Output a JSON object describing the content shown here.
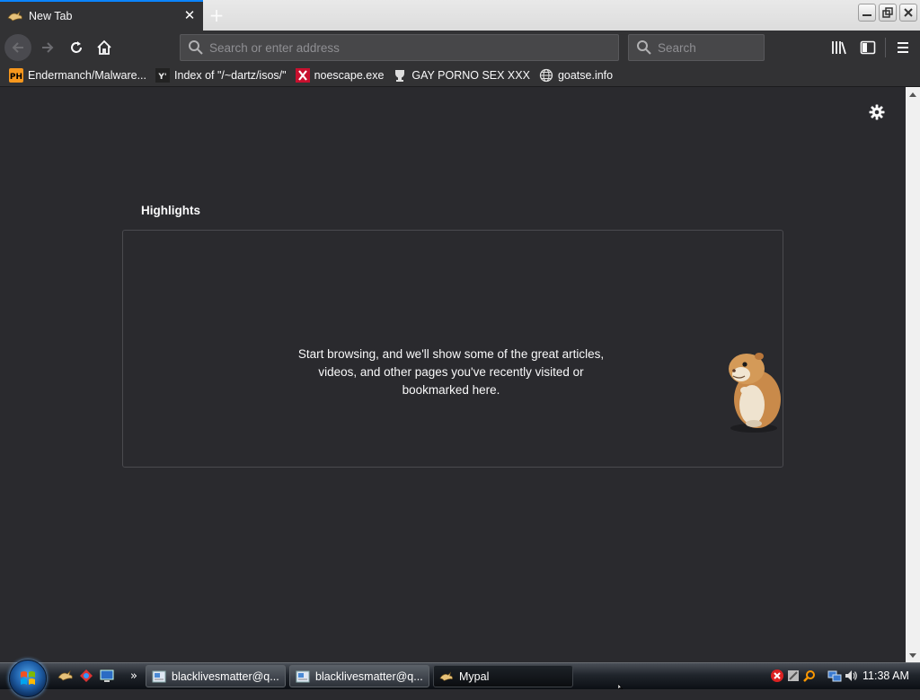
{
  "tabs": [
    {
      "title": "New Tab",
      "icon": "mypal-favicon-icon",
      "active": true
    }
  ],
  "window_controls": {
    "minimize": "minimize-icon",
    "restore": "restore-icon",
    "close": "close-icon"
  },
  "navbar": {
    "url_placeholder": "Search or enter address",
    "search_placeholder": "Search"
  },
  "bookmarks": [
    {
      "label": "Endermanch/Malware...",
      "icon": "ph-icon"
    },
    {
      "label": "Index of \"/~dartz/isos/\"",
      "icon": "yc-icon"
    },
    {
      "label": "noescape.exe",
      "icon": "x-icon"
    },
    {
      "label": "GAY PORNO SEX XXX",
      "icon": "trophy-icon"
    },
    {
      "label": "goatse.info",
      "icon": "globe-icon"
    }
  ],
  "content": {
    "highlights_title": "Highlights",
    "empty_message": "Start browsing, and we'll show some of the great articles, videos, and other pages you've recently visited or bookmarked here."
  },
  "taskbar": {
    "buttons": [
      {
        "label": "blacklivesmatter@q...",
        "icon": "mail-icon",
        "active": false
      },
      {
        "label": "blacklivesmatter@q...",
        "icon": "mail-icon",
        "active": false
      },
      {
        "label": "Mypal",
        "icon": "mypal-icon",
        "active": true
      }
    ],
    "overflow": "»",
    "clock": "11:38 AM"
  },
  "colors": {
    "page_bg": "#2a2a2e",
    "toolbar_bg": "#323234",
    "accent": "#0a84ff"
  }
}
